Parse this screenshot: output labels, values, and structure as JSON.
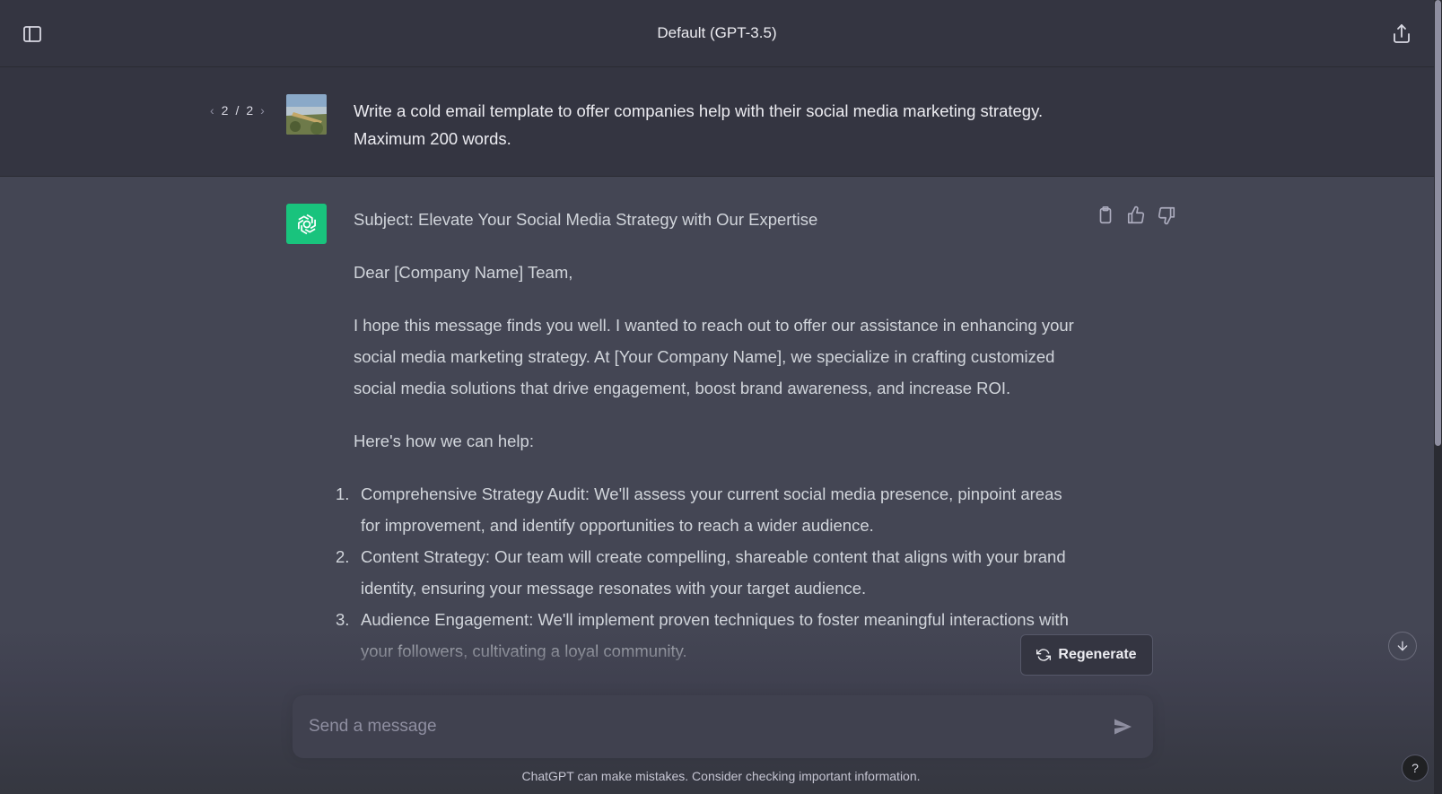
{
  "header": {
    "title": "Default (GPT-3.5)"
  },
  "user_message": {
    "pager": {
      "current": "2",
      "separator": "/",
      "total": "2"
    },
    "text": "Write a cold email template to offer companies help with their social media marketing strategy. Maximum 200 words."
  },
  "assistant_message": {
    "subject": "Subject: Elevate Your Social Media Strategy with Our Expertise",
    "greeting": "Dear [Company Name] Team,",
    "paragraph1": "I hope this message finds you well. I wanted to reach out to offer our assistance in enhancing your social media marketing strategy. At [Your Company Name], we specialize in crafting customized social media solutions that drive engagement, boost brand awareness, and increase ROI.",
    "intro_list": "Here's how we can help:",
    "items": [
      {
        "num": "1.",
        "text": "Comprehensive Strategy Audit: We'll assess your current social media presence, pinpoint areas for improvement, and identify opportunities to reach a wider audience."
      },
      {
        "num": "2.",
        "text": "Content Strategy: Our team will create compelling, shareable content that aligns with your brand identity, ensuring your message resonates with your target audience."
      },
      {
        "num": "3.",
        "text": "Audience Engagement: We'll implement proven techniques to foster meaningful interactions with your followers, cultivating a loyal community."
      }
    ]
  },
  "regenerate_label": "Regenerate",
  "composer": {
    "placeholder": "Send a message"
  },
  "footer": {
    "disclaimer": "ChatGPT can make mistakes. Consider checking important information.",
    "help_label": "?"
  },
  "icons": {
    "sidebar": "sidebar-toggle-icon",
    "share": "share-icon",
    "copy": "clipboard-icon",
    "like": "thumbs-up-icon",
    "dislike": "thumbs-down-icon",
    "regen": "refresh-icon",
    "send": "send-icon",
    "scroll": "arrow-down-icon"
  },
  "colors": {
    "accent": "#19c37d",
    "background": "#444654",
    "header": "#343541"
  }
}
